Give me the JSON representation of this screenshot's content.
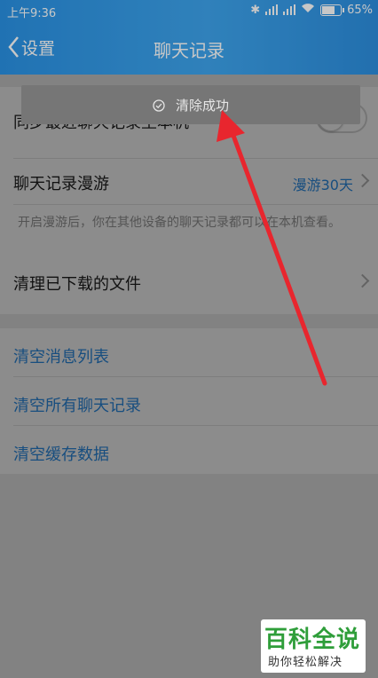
{
  "status_bar": {
    "time": "上午9:36",
    "battery": "65%"
  },
  "nav": {
    "back_label": "设置",
    "title": "聊天记录"
  },
  "settings": {
    "sync_label": "同步最近聊天记录至本机",
    "roaming_label": "聊天记录漫游",
    "roaming_value": "漫游30天",
    "roaming_desc": "开启漫游后，你在其他设备的聊天记录都可以在本机查看。",
    "clean_files_label": "清理已下载的文件",
    "clear_messages": "清空消息列表",
    "clear_all_chats": "清空所有聊天记录",
    "clear_cache": "清空缓存数据"
  },
  "toast": {
    "text": "清除成功"
  },
  "watermark": {
    "brand": "百科全说",
    "slogan": "助你轻松解决"
  },
  "colors": {
    "header": "#2a93e6",
    "link": "#2d8fe8",
    "arrow": "#e8262e",
    "watermark_green": "#2f9e3a"
  }
}
